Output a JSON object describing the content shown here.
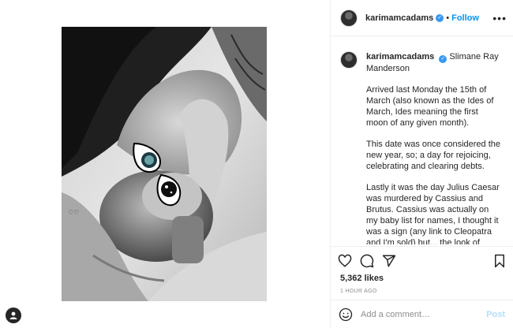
{
  "post": {
    "username": "karimamcadams",
    "follow_label": "Follow",
    "separator": "•",
    "more_label": "•••",
    "verified_glyph": "✓",
    "mention": "Slimane Ray Manderson",
    "caption_paragraphs": [
      "Arrived last Monday the 15th of March (also known as the Ides of March, Ides meaning the first moon of any given month).",
      "This date was once considered the new year, so; a day for rejoicing, celebrating and clearing debts.",
      "Lastly it was the day Julius Caesar was murdered by Cassius and Brutus. Cassius was actually on my baby list for names, I thought it was a sign (any link to Cleopatra and I'm sold) but... the look of delusion coming at me from Stephen's face was enough to park that idea, so we"
    ],
    "likes": "5,362 likes",
    "time_ago": "1 HOUR AGO",
    "comment_placeholder": "Add a comment…",
    "post_label": "Post"
  },
  "icons": {
    "like": "heart-icon",
    "comment": "comment-icon",
    "share": "share-icon",
    "save": "bookmark-icon",
    "emoji": "emoji-icon",
    "more": "more-options-icon"
  },
  "colors": {
    "accent": "#0095f6",
    "verified": "#3897f0",
    "post_disabled": "#b2dffc",
    "muted": "#8e8e8e"
  }
}
